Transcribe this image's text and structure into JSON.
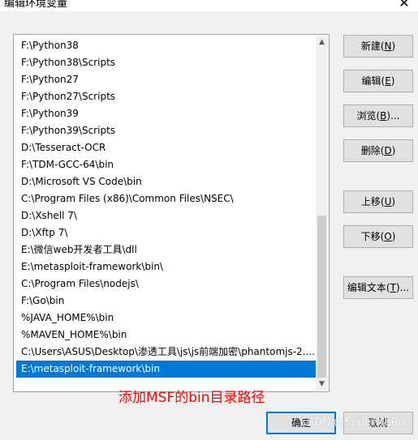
{
  "window": {
    "title": "编辑环境变量",
    "close_glyph": "✕"
  },
  "path_list": {
    "items": [
      "F:\\Python38",
      "F:\\Python38\\Scripts",
      "F:\\Python27",
      "F:\\Python27\\Scripts",
      "F:\\Python39",
      "F:\\Python39\\Scripts",
      "D:\\Tesseract-OCR",
      "F:\\TDM-GCC-64\\bin",
      "D:\\Microsoft VS Code\\bin",
      "C:\\Program Files (x86)\\Common Files\\NSEC\\",
      "D:\\Xshell 7\\",
      "D:\\Xftp 7\\",
      "E:\\微信web开发者工具\\dll",
      "E:\\metasploit-framework\\bin\\",
      "C:\\Program Files\\nodejs\\",
      "F:\\Go\\bin",
      "%JAVA_HOME%\\bin",
      "%MAVEN_HOME%\\bin",
      "C:\\Users\\ASUS\\Desktop\\渗透工具\\js\\js前端加密\\phantomjs-2....",
      "E:\\metasploit-framework\\bin"
    ],
    "selected_index": 19
  },
  "scrollbar": {
    "up_glyph": "▲",
    "down_glyph": "▼"
  },
  "buttons": {
    "new": {
      "label": "新建(",
      "key": "N",
      "close": ")"
    },
    "edit": {
      "label": "编辑(",
      "key": "E",
      "close": ")"
    },
    "browse": {
      "label": "浏览(",
      "key": "B",
      "close": ")..."
    },
    "delete": {
      "label": "删除(",
      "key": "D",
      "close": ")"
    },
    "move_up": {
      "label": "上移(",
      "key": "U",
      "close": ")"
    },
    "move_down": {
      "label": "下移(",
      "key": "O",
      "close": ")"
    },
    "edit_text": {
      "label": "编辑文本(",
      "key": "T",
      "close": ")..."
    },
    "ok": "确定",
    "cancel": "取消"
  },
  "annotation": "添加MSF的bin目录路径",
  "watermark": "CSDN @SuperMeRo",
  "colors": {
    "selection": "#0078d7",
    "annotation": "#ff0000"
  }
}
